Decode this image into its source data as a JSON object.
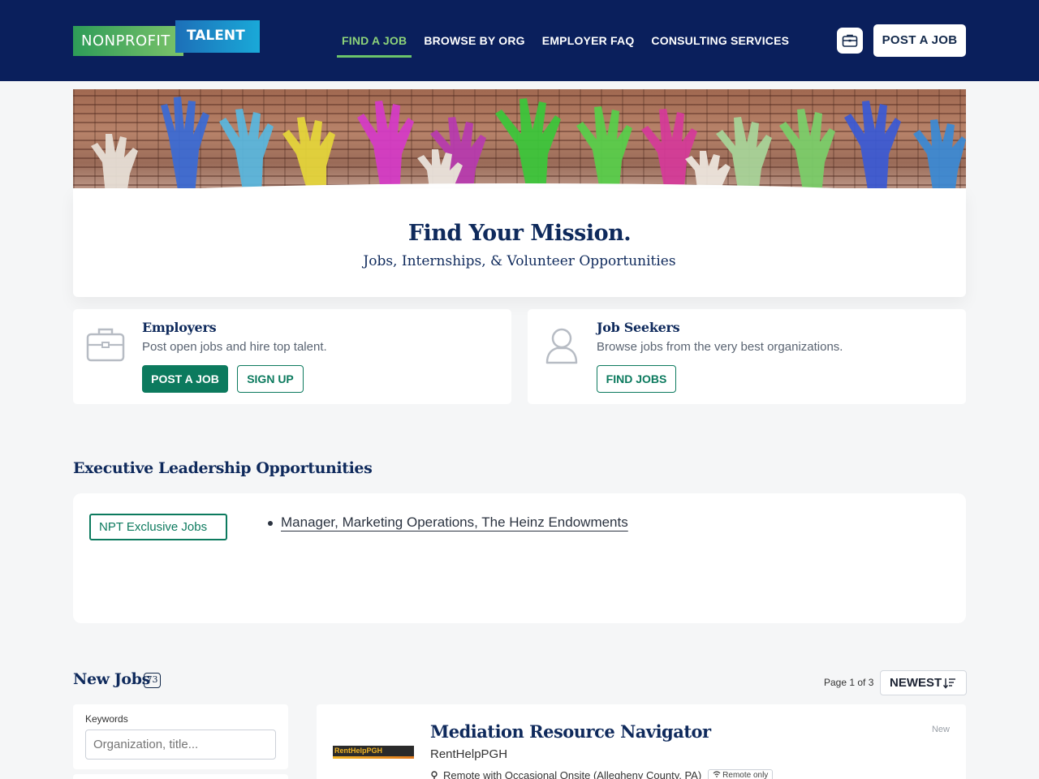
{
  "header": {
    "logo": {
      "left": "NONPROFIT",
      "right": "TALENT"
    },
    "nav": [
      {
        "label": "FIND A JOB",
        "active": true
      },
      {
        "label": "BROWSE BY ORG",
        "active": false
      },
      {
        "label": "EMPLOYER FAQ",
        "active": false
      },
      {
        "label": "CONSULTING SERVICES",
        "active": false
      }
    ],
    "bag_icon": "briefcase-icon",
    "post_job_label": "POST A JOB"
  },
  "hero": {
    "title": "Find Your Mission.",
    "subtitle": "Jobs, Internships, & Volunteer Opportunities"
  },
  "employers": {
    "icon": "briefcase-icon",
    "title": "Employers",
    "description": "Post open jobs and hire top talent.",
    "post_label": "POST A JOB",
    "signup_label": "SIGN UP"
  },
  "seekers": {
    "icon": "person-icon",
    "title": "Job Seekers",
    "description": "Browse jobs from the very best organizations.",
    "find_label": "FIND JOBS"
  },
  "executive": {
    "title": "Executive Leadership Opportunities",
    "tag": "NPT Exclusive Jobs",
    "items": [
      "Manager, Marketing Operations, The Heinz Endowments"
    ]
  },
  "new_jobs": {
    "title": "New Jobs",
    "count": "73",
    "page_info": "Page 1 of 3",
    "sort_label": "NEWEST",
    "filter": {
      "label": "Keywords",
      "placeholder": "Organization, title..."
    },
    "jobs": [
      {
        "title": "Mediation Resource Navigator",
        "org": "RentHelpPGH",
        "logo_text": "RentHelpPGH",
        "location": "Remote with Occasional Onsite (Allegheny County, PA)",
        "remote_badge": "Remote only",
        "status": "New"
      }
    ]
  },
  "colors": {
    "navy": "#0a1f5c",
    "green": "#0c7a5e",
    "active_nav": "#8dd37a"
  }
}
